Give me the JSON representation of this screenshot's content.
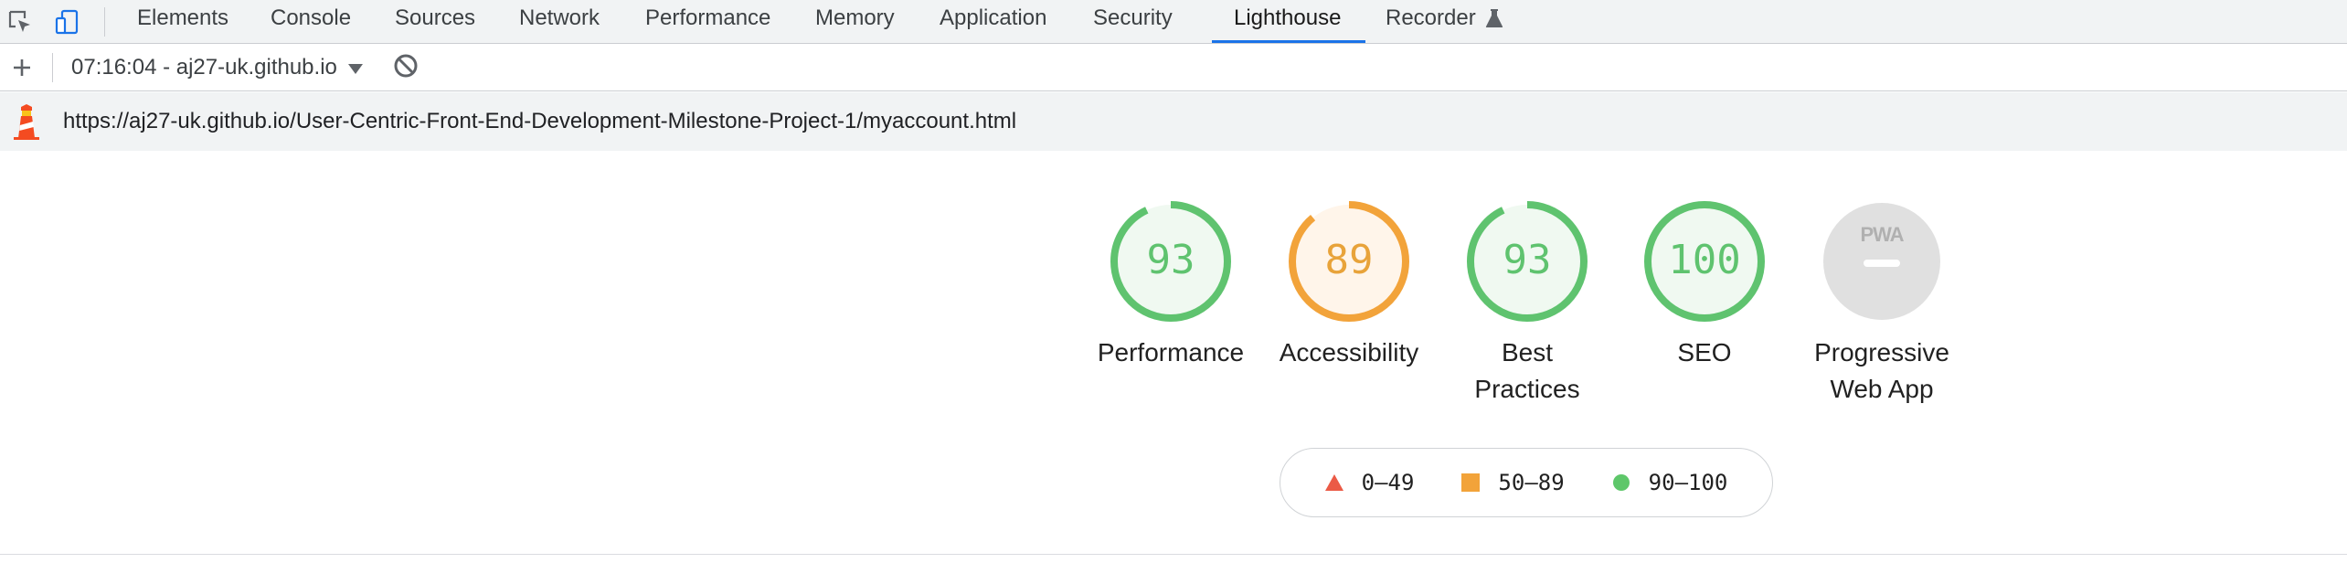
{
  "tabs": [
    {
      "label": "Elements"
    },
    {
      "label": "Console"
    },
    {
      "label": "Sources"
    },
    {
      "label": "Network"
    },
    {
      "label": "Performance"
    },
    {
      "label": "Memory"
    },
    {
      "label": "Application"
    },
    {
      "label": "Security"
    },
    {
      "label": "Lighthouse"
    },
    {
      "label": "Recorder"
    }
  ],
  "active_tab": "Lighthouse",
  "toolbar": {
    "report_label": "07:16:04 - aj27-uk.github.io"
  },
  "url": "https://aj27-uk.github.io/User-Centric-Front-End-Development-Milestone-Project-1/myaccount.html",
  "scores": [
    {
      "label": "Performance",
      "value": "93",
      "status": "pass"
    },
    {
      "label": "Accessibility",
      "value": "89",
      "status": "average"
    },
    {
      "label": "Best Practices",
      "value": "93",
      "status": "pass"
    },
    {
      "label": "SEO",
      "value": "100",
      "status": "pass"
    },
    {
      "label": "Progressive Web App",
      "value": "",
      "badge": "PWA",
      "status": "na"
    }
  ],
  "legend": [
    {
      "range": "0–49",
      "shape": "triangle",
      "color": "#eb5a46"
    },
    {
      "range": "50–89",
      "shape": "square",
      "color": "#f2a33a"
    },
    {
      "range": "90–100",
      "shape": "circle",
      "color": "#5ec76a"
    }
  ],
  "colors": {
    "pass": "#0c7a3c",
    "pass_ring": "#5fc36f",
    "pass_fill": "#f0f9f1",
    "average_text": "#e8a33a",
    "average_ring": "#f2a33a",
    "average_fill": "#fff5ea",
    "na_fill": "#e0e0e0",
    "accent": "#1a73e8"
  }
}
